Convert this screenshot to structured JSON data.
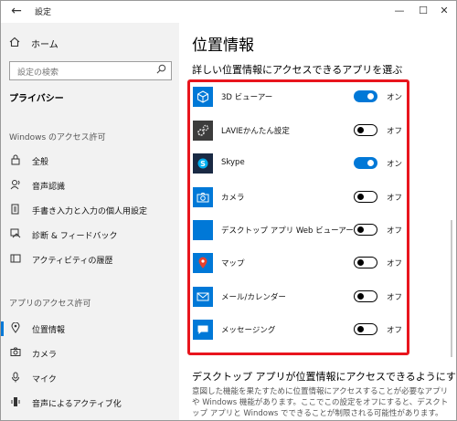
{
  "window": {
    "title": "設定",
    "back_icon": "back-arrow-icon",
    "minimize_glyph": "—",
    "maximize_glyph": "☐",
    "close_glyph": "✕"
  },
  "sidebar": {
    "home_label": "ホーム",
    "search_placeholder": "設定の検索",
    "category_title": "プライバシー",
    "windows_section_title": "Windows のアクセス許可",
    "windows_items": [
      {
        "label": "全般",
        "icon": "lock-icon"
      },
      {
        "label": "音声認識",
        "icon": "speech-icon"
      },
      {
        "label": "手書き入力と入力の個人用設定",
        "icon": "notepad-icon"
      },
      {
        "label": "診断 & フィードバック",
        "icon": "diagnostics-icon"
      },
      {
        "label": "アクティビティの履歴",
        "icon": "history-icon"
      }
    ],
    "app_section_title": "アプリのアクセス許可",
    "app_items": [
      {
        "label": "位置情報",
        "icon": "location-icon",
        "active": true
      },
      {
        "label": "カメラ",
        "icon": "camera-icon"
      },
      {
        "label": "マイク",
        "icon": "microphone-icon"
      },
      {
        "label": "音声によるアクティブ化",
        "icon": "voice-activation-icon"
      }
    ]
  },
  "main": {
    "title": "位置情報",
    "subtitle": "詳しい位置情報にアクセスできるアプリを選ぶ",
    "apps": [
      {
        "name": "3D ビューアー",
        "state": "オン",
        "on": true,
        "icon": "cube-icon",
        "color": "#0078d7"
      },
      {
        "name": "LAVIEかんたん設定",
        "state": "オフ",
        "on": false,
        "icon": "gear-icon",
        "color": "#3c3c3c"
      },
      {
        "name": "Skype",
        "state": "オン",
        "on": true,
        "icon": "skype-icon",
        "color": "#1a2a44"
      },
      {
        "name": "カメラ",
        "state": "オフ",
        "on": false,
        "icon": "camera-icon",
        "color": "#0078d7"
      },
      {
        "name": "デスクトップ アプリ Web ビューアー",
        "state": "オフ",
        "on": false,
        "icon": "web-viewer-icon",
        "color": "#0078d7"
      },
      {
        "name": "マップ",
        "state": "オフ",
        "on": false,
        "icon": "maps-icon",
        "color": "#0078d7"
      },
      {
        "name": "メール/カレンダー",
        "state": "オフ",
        "on": false,
        "icon": "mail-icon",
        "color": "#0078d7"
      },
      {
        "name": "メッセージング",
        "state": "オフ",
        "on": false,
        "icon": "messaging-icon",
        "color": "#0078d7"
      }
    ],
    "footer_title": "デスクトップ アプリが位置情報にアクセスできるようにする",
    "footer_text": "意図した機能を果たすために位置情報にアクセスすることが必要なアプリや Windows 機能があります。ここでこの設定をオフにすると、デスクトップ アプリと Windows でできることが制限される可能性があります。"
  },
  "colors": {
    "accent": "#0078d7",
    "highlight": "#e8151d",
    "sidebar_bg": "#f2f2f2"
  }
}
